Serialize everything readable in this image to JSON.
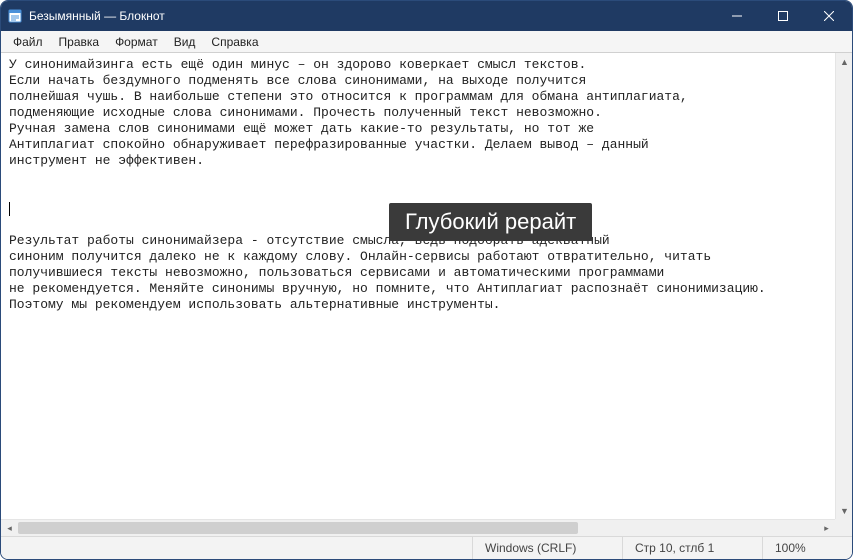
{
  "titlebar": {
    "title": "Безымянный — Блокнот"
  },
  "menu": {
    "file": "Файл",
    "edit": "Правка",
    "format": "Формат",
    "view": "Вид",
    "help": "Справка"
  },
  "editor": {
    "paragraph1": "У синонимайзинга есть ещё один минус – он здорово коверкает смысл текстов.\nЕсли начать бездумного подменять все слова синонимами, на выходе получится\nполнейшая чушь. В наибольше степени это относится к программам для обмана антиплагиата,\nподменяющие исходные слова синонимами. Прочесть полученный текст невозможно.\nРучная замена слов синонимами ещё может дать какие-то результаты, но тот же\nАнтиплагиат спокойно обнаруживает перефразированные участки. Делаем вывод – данный\nинструмент не эффективен.",
    "paragraph2": "Результат работы синонимайзера - отсутствие смысла, ведь подобрать адекватный\nсиноним получится далеко не к каждому слову. Онлайн-сервисы работают отвратительно, читать\nполучившиеся тексты невозможно, пользоваться сервисами и автоматическими программами\nне рекомендуется. Меняйте синонимы вручную, но помните, что Антиплагиат распознаёт синонимизацию.\nПоэтому мы рекомендуем использовать альтернативные инструменты."
  },
  "overlay": {
    "text": "Глубокий рерайт"
  },
  "status": {
    "encoding": "Windows (CRLF)",
    "position": "Стр 10, стлб 1",
    "zoom": "100%"
  }
}
